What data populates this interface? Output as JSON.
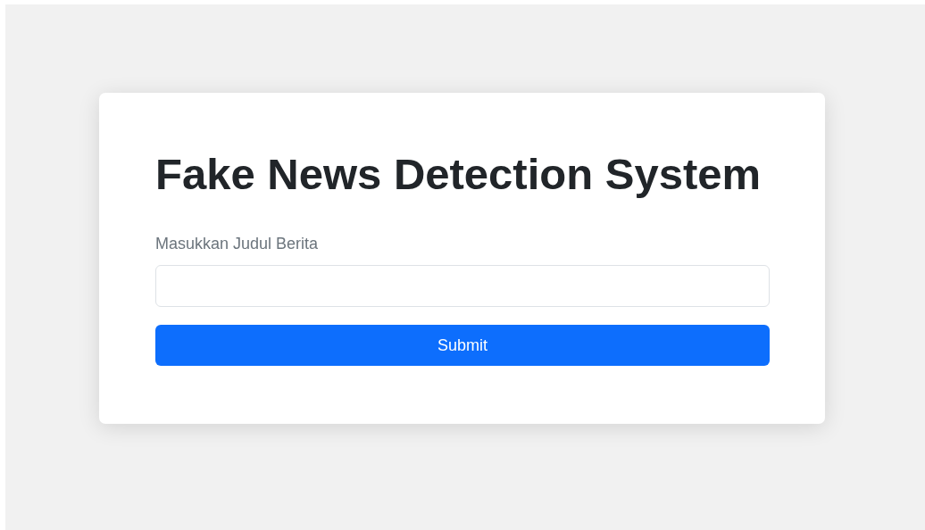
{
  "title": "Fake News Detection System",
  "form": {
    "label": "Masukkan Judul Berita",
    "submit": "Submit"
  }
}
